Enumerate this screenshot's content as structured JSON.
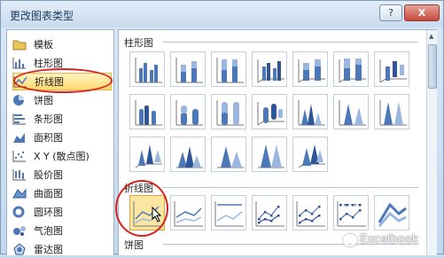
{
  "window": {
    "title": "更改图表类型",
    "help_label": "?",
    "close_label": "X"
  },
  "sidebar": {
    "items": [
      {
        "label": "模板",
        "icon": "folder-icon"
      },
      {
        "label": "柱形图",
        "icon": "column-chart-icon"
      },
      {
        "label": "折线图",
        "icon": "line-chart-icon",
        "selected": true
      },
      {
        "label": "饼图",
        "icon": "pie-chart-icon"
      },
      {
        "label": "条形图",
        "icon": "bar-chart-icon"
      },
      {
        "label": "面积图",
        "icon": "area-chart-icon"
      },
      {
        "label": "X Y (散点图)",
        "icon": "scatter-chart-icon"
      },
      {
        "label": "股价图",
        "icon": "stock-chart-icon"
      },
      {
        "label": "曲面图",
        "icon": "surface-chart-icon"
      },
      {
        "label": "圆环图",
        "icon": "doughnut-chart-icon"
      },
      {
        "label": "气泡图",
        "icon": "bubble-chart-icon"
      },
      {
        "label": "雷达图",
        "icon": "radar-chart-icon"
      }
    ]
  },
  "main": {
    "sections": [
      {
        "heading": "柱形图",
        "thumbnails": [
          "clustered-column-icon",
          "stacked-column-icon",
          "100-stacked-column-icon",
          "3d-clustered-column-icon",
          "3d-stacked-column-icon",
          "3d-100-stacked-column-icon",
          "3d-column-icon",
          "clustered-cylinder-icon",
          "stacked-cylinder-icon",
          "100-stacked-cylinder-icon",
          "3d-cylinder-icon",
          "clustered-cone-icon",
          "stacked-cone-icon",
          "100-stacked-cone-icon",
          "3d-cone-icon",
          "clustered-pyramid-icon",
          "stacked-pyramid-icon",
          "100-stacked-pyramid-icon",
          "3d-pyramid-icon"
        ]
      },
      {
        "heading": "折线图",
        "thumbnails": [
          "line-icon",
          "stacked-line-icon",
          "100-stacked-line-icon",
          "line-with-markers-icon",
          "stacked-line-with-markers-icon",
          "100-stacked-line-with-markers-icon",
          "3d-line-icon"
        ]
      },
      {
        "heading": "饼图",
        "thumbnails": []
      }
    ]
  },
  "watermark": {
    "text": "Excelbook"
  },
  "colors": {
    "accent_ring": "#d8221c",
    "selection": "#ffd970"
  }
}
